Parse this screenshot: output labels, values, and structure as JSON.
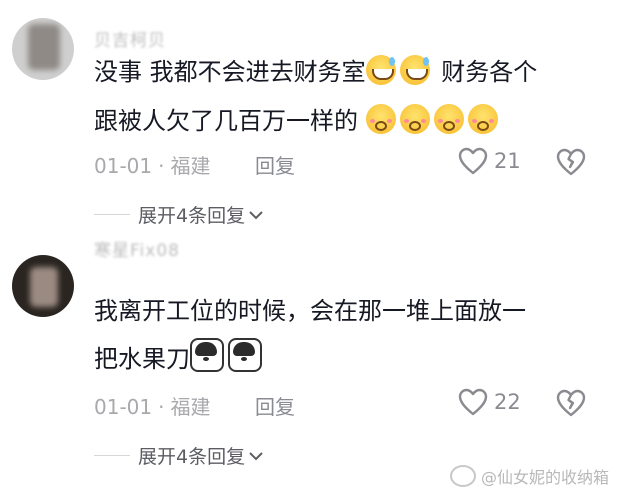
{
  "comments": [
    {
      "username": "贝吉柯贝",
      "line1": "没事 我都不会进去财务室",
      "line1_emojis": [
        "grinning-sweat-emoji",
        "grinning-sweat-emoji"
      ],
      "line1_after": " 财务各个",
      "line2": "跟被人欠了几百万一样的 ",
      "line2_emojis": [
        "kiss-emoji",
        "kiss-emoji",
        "kiss-emoji",
        "kiss-emoji"
      ],
      "date": "01-01",
      "location": "福建",
      "reply_label": "回复",
      "likes": "21",
      "expand_label": "展开4条回复"
    },
    {
      "username": "寒星Fix08",
      "line1": "我离开工位的时候，会在那一堆上面放一",
      "line2": "把水果刀",
      "line2_emojis": [
        "husky-emoji",
        "husky-emoji"
      ],
      "date": "01-01",
      "location": "福建",
      "reply_label": "回复",
      "likes": "22",
      "expand_label": "展开4条回复"
    }
  ],
  "watermark": "@仙女妮的收纳箱",
  "separator": "·"
}
